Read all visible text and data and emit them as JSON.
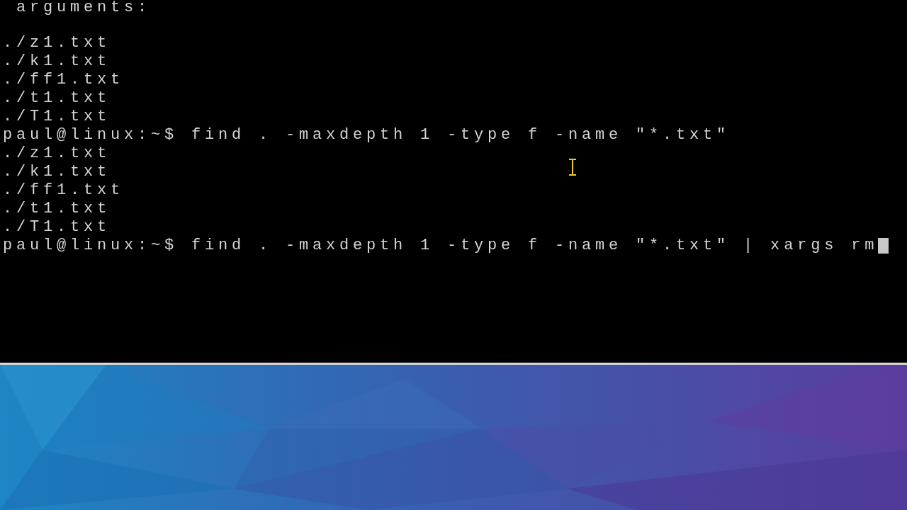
{
  "terminal": {
    "lines": [
      {
        "kind": "output",
        "text": " arguments:"
      },
      {
        "kind": "blank"
      },
      {
        "kind": "output",
        "text": "./z1.txt"
      },
      {
        "kind": "output",
        "text": "./k1.txt"
      },
      {
        "kind": "output",
        "text": "./ff1.txt"
      },
      {
        "kind": "output",
        "text": "./t1.txt"
      },
      {
        "kind": "output",
        "text": "./T1.txt"
      },
      {
        "kind": "command",
        "prompt": "paul@linux:~$",
        "text": "find . -maxdepth 1 -type f -name \"*.txt\"",
        "cursor": false
      },
      {
        "kind": "output",
        "text": "./z1.txt"
      },
      {
        "kind": "output",
        "text": "./k1.txt"
      },
      {
        "kind": "output",
        "text": "./ff1.txt"
      },
      {
        "kind": "output",
        "text": "./t1.txt"
      },
      {
        "kind": "output",
        "text": "./T1.txt"
      },
      {
        "kind": "command",
        "prompt": "paul@linux:~$",
        "text": "find . -maxdepth 1 -type f -name \"*.txt\" | xargs rm",
        "cursor": true
      }
    ]
  }
}
